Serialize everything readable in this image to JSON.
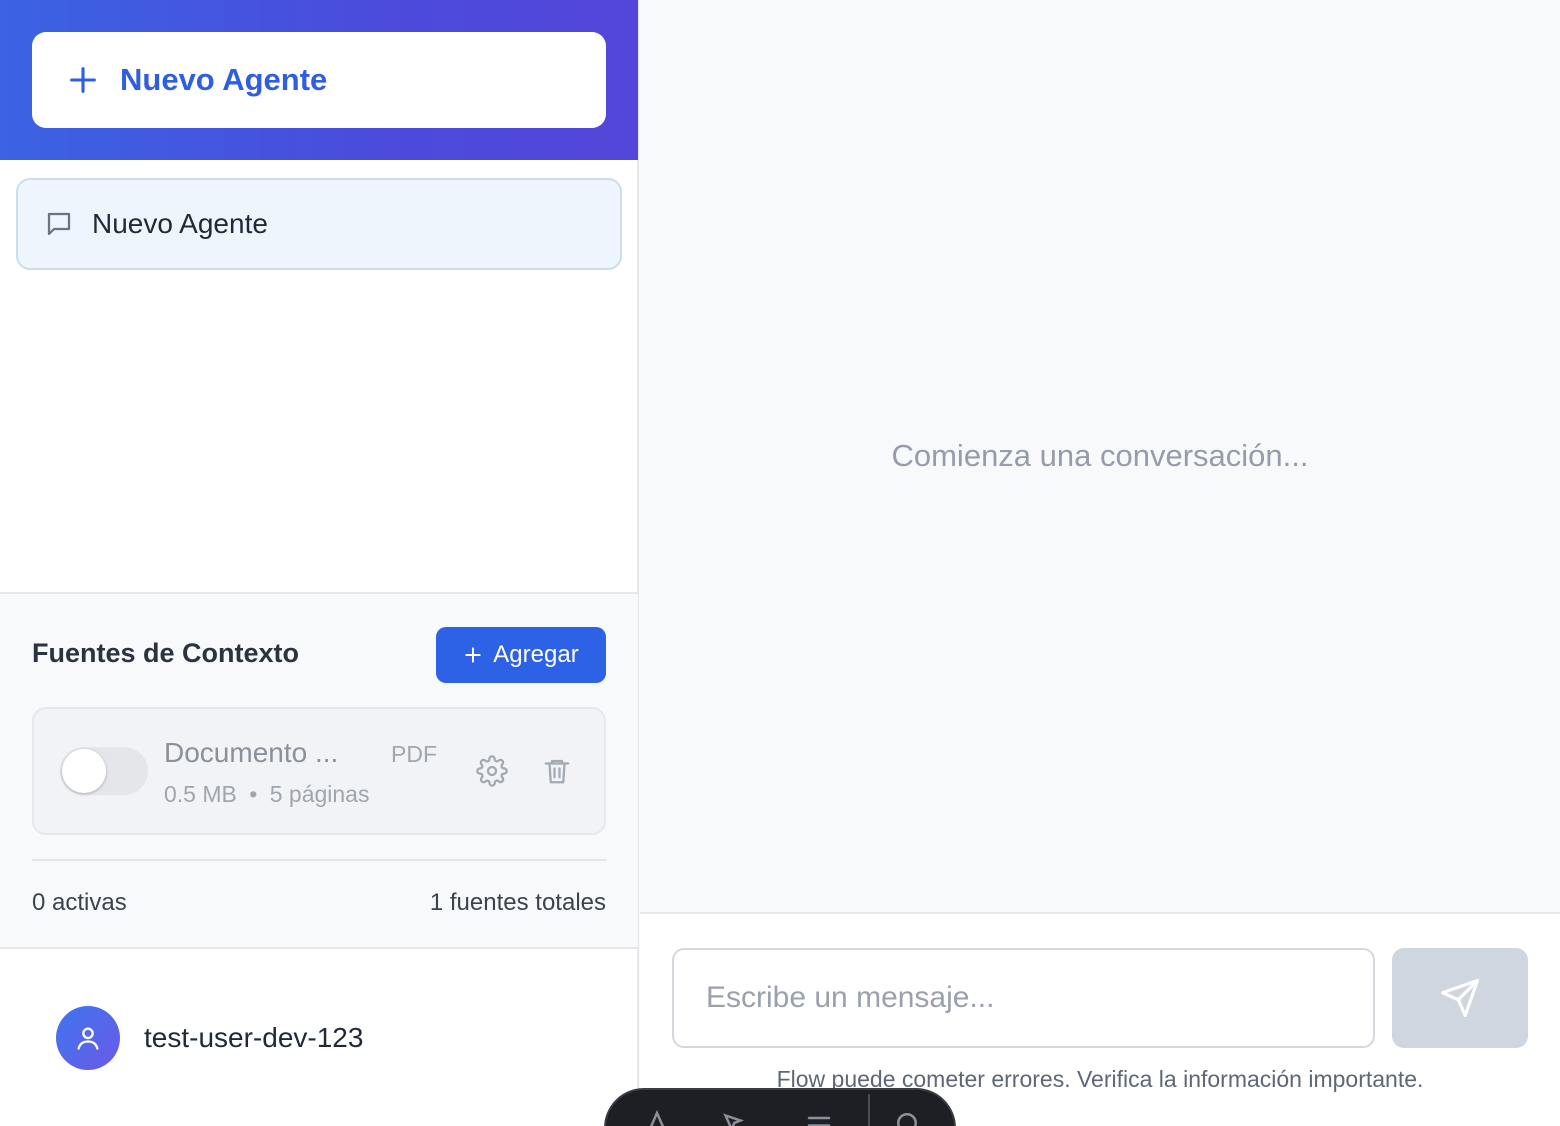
{
  "sidebar": {
    "new_agent_button": "Nuevo Agente",
    "agents": [
      {
        "label": "Nuevo Agente",
        "icon": "chat-bubble-icon"
      }
    ],
    "context": {
      "title": "Fuentes de Contexto",
      "add_button": "Agregar",
      "sources": [
        {
          "name": "Documento ...",
          "type": "PDF",
          "size": "0.5 MB",
          "separator": "•",
          "pages": "5 páginas",
          "enabled": false
        }
      ],
      "active_count": "0 activas",
      "total_count": "1 fuentes totales"
    },
    "user": {
      "name": "test-user-dev-123",
      "icon": "user-icon"
    }
  },
  "main": {
    "empty_state": "Comienza una conversación...",
    "input": {
      "placeholder": "Escribe un mensaje...",
      "value": ""
    },
    "send_icon": "send-icon",
    "disclaimer": "Flow puede cometer errores. Verifica la información importante."
  },
  "colors": {
    "accent": "#2e62e6",
    "header_gradient_start": "#3b63e3",
    "header_gradient_end": "#5446da",
    "send_disabled": "#d0d6df"
  }
}
